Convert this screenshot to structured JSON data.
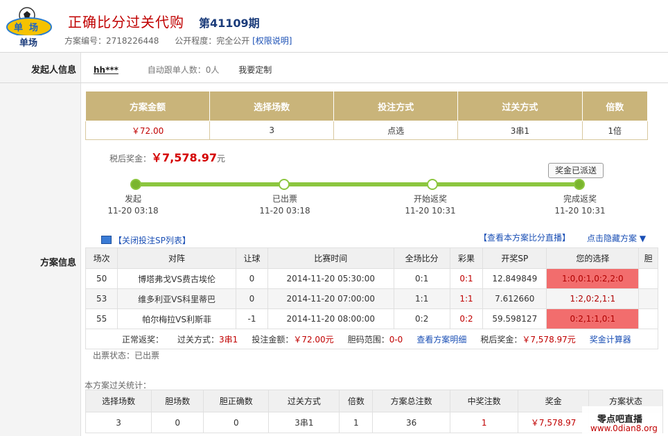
{
  "header": {
    "logo_text": "单场",
    "title": "正确比分过关代购",
    "issue": "第41109期",
    "plan_no_label": "方案编号：",
    "plan_no": "2718226448",
    "visibility_label": "公开程度：",
    "visibility": "完全公开",
    "permission_link": "[权限说明]"
  },
  "initiator": {
    "section_label": "发起人信息",
    "username": "hh***",
    "follow_label": "自动跟单人数：",
    "follow_count": "0人",
    "custom_link": "我要定制"
  },
  "plan": {
    "section_label": "方案信息",
    "summary_headers": [
      "方案金额",
      "选择场数",
      "投注方式",
      "过关方式",
      "倍数"
    ],
    "summary_values": [
      "￥72.00",
      "3",
      "点选",
      "3串1",
      "1倍"
    ],
    "prize_label": "税后奖金：",
    "prize_amount": "￥7,578.97",
    "prize_unit": "元",
    "prize_sent_button": "奖金已派送",
    "progress_fraction": 1.0,
    "timeline": [
      {
        "label": "发起",
        "time": "11-20 03:18"
      },
      {
        "label": "已出票",
        "time": "11-20 03:18"
      },
      {
        "label": "开始返奖",
        "time": "11-20 10:31"
      },
      {
        "label": "完成返奖",
        "time": "11-20 10:31"
      }
    ],
    "sp_toggle": "【关闭投注SP列表】",
    "live_link": "【查看本方案比分直播】",
    "hide_link": "点击隐藏方案",
    "hide_arrow": "▼",
    "matches_headers": [
      "场次",
      "对阵",
      "让球",
      "比赛时间",
      "全场比分",
      "彩果",
      "开奖SP",
      "您的选择",
      "胆"
    ],
    "matches": [
      {
        "no": "50",
        "match": "博塔弗戈VS费古埃伦",
        "handicap": "0",
        "time": "2014-11-20 05:30:00",
        "score": "0:1",
        "result": "0:1",
        "sp": "12.849849",
        "choice": "1:0,0:1,0:2,2:0",
        "banker": ""
      },
      {
        "no": "53",
        "match": "维多利亚VS科里蒂巴",
        "handicap": "0",
        "time": "2014-11-20 07:00:00",
        "score": "1:1",
        "result": "1:1",
        "sp": "7.612660",
        "choice": "1:2,0:2,1:1",
        "banker": ""
      },
      {
        "no": "55",
        "match": "帕尔梅拉VS利斯菲",
        "handicap": "-1",
        "time": "2014-11-20 08:00:00",
        "score": "0:2",
        "result": "0:2",
        "sp": "59.598127",
        "choice": "0:2,1:1,0:1",
        "banker": ""
      }
    ],
    "footer": {
      "status": "正常返奖：",
      "pass_label": "过关方式：",
      "pass_value": "3串1",
      "amount_label": "投注金额：",
      "amount_value": "￥72.00元",
      "banker_label": "胆码范围：",
      "banker_value": "0-0",
      "detail_link": "查看方案明细",
      "tax_label": "税后奖金：",
      "tax_value": "￥7,578.97元",
      "calc_link": "奖金计算器"
    },
    "ticket_status": "出票状态：已出票",
    "stats_title": "本方案过关统计：",
    "stats_headers": [
      "选择场数",
      "胆场数",
      "胆正确数",
      "过关方式",
      "倍数",
      "方案总注数",
      "中奖注数",
      "奖金",
      "方案状态"
    ],
    "stats_values": [
      "3",
      "0",
      "0",
      "3串1",
      "1",
      "36",
      "1",
      "￥7,578.97",
      ""
    ]
  },
  "watermark": {
    "line1": "零点吧直播",
    "line2": "www.0dian8.org"
  }
}
